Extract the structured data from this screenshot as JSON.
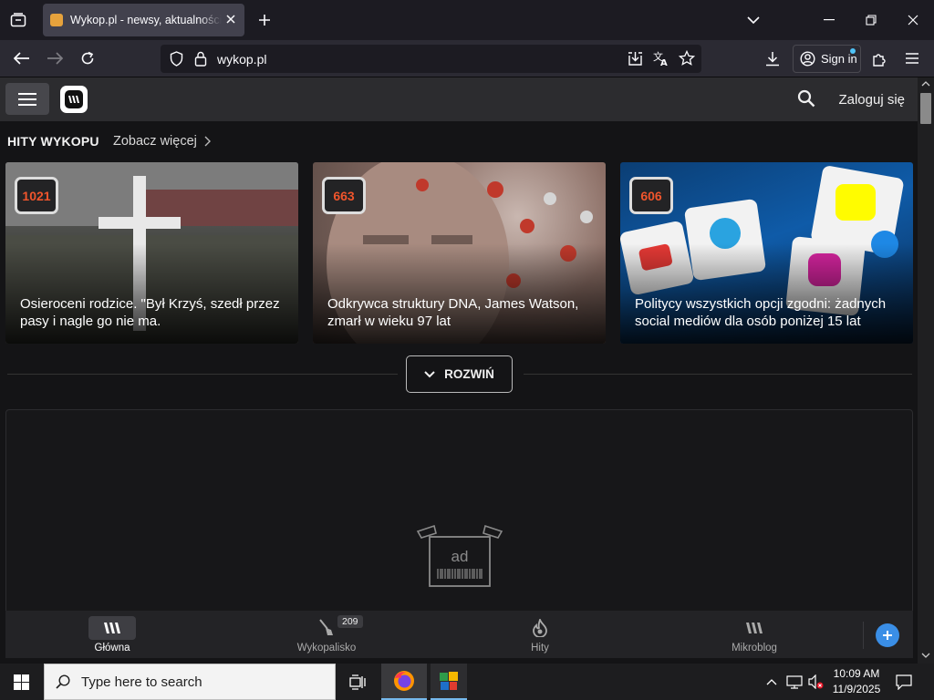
{
  "browser": {
    "tab_title": "Wykop.pl - newsy, aktualności, gry",
    "url": "wykop.pl",
    "sign_in_label": "Sign in"
  },
  "site": {
    "login_label": "Zaloguj się"
  },
  "hits": {
    "heading": "HITY WYKOPU",
    "more_label": "Zobacz więcej",
    "cards": [
      {
        "votes": "1021",
        "title": "Osieroceni rodzice. \"Był Krzyś, szedł przez pasy i nagle go nie ma."
      },
      {
        "votes": "663",
        "title": "Odkrywca struktury DNA, James Watson, zmarł w wieku 97 lat"
      },
      {
        "votes": "606",
        "title": "Politycy wszystkich opcji zgodni: żadnych social mediów dla osób poniżej 15 lat"
      }
    ],
    "expand_label": "ROZWIŃ"
  },
  "ad": {
    "label": "ad"
  },
  "bottom_nav": {
    "items": [
      {
        "label": "Główna"
      },
      {
        "label": "Wykopalisko",
        "badge": "209"
      },
      {
        "label": "Hity"
      },
      {
        "label": "Mikroblog"
      }
    ]
  },
  "taskbar": {
    "search_placeholder": "Type here to search",
    "time": "10:09 AM",
    "date": "11/9/2025"
  },
  "colors": {
    "accent_orange": "#f0552c",
    "accent_blue": "#3a8ee6"
  }
}
